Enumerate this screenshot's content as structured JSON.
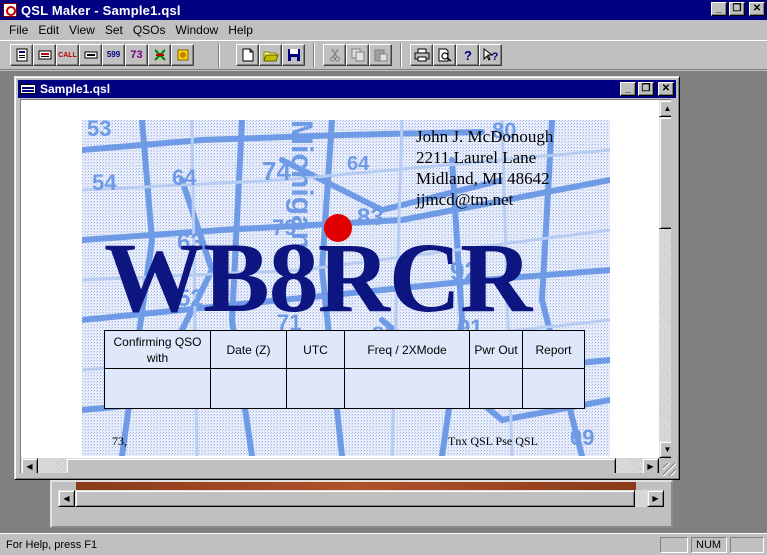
{
  "app": {
    "title": "QSL Maker - Sample1.qsl"
  },
  "window_buttons": {
    "minimize": "_",
    "restore": "❐",
    "close": "✕"
  },
  "menu": [
    "File",
    "Edit",
    "View",
    "Set",
    "QSOs",
    "Window",
    "Help"
  ],
  "toolbar": {
    "group1_labels": [
      "",
      "",
      "CALL",
      "",
      "599",
      "73",
      "",
      ""
    ],
    "group2": [
      "new-icon",
      "open-icon",
      "save-icon"
    ],
    "group3": [
      "cut-icon",
      "copy-icon",
      "paste-icon"
    ],
    "group4": [
      "print-icon",
      "print-preview-icon",
      "help-icon",
      "context-help-icon"
    ]
  },
  "document": {
    "title": "Sample1.qsl"
  },
  "card": {
    "address": [
      "John J. McDonough",
      "2211 Laurel Lane",
      "Midland, MI 48642",
      "jjmcd@tm.net"
    ],
    "callsign": "WB8RCR",
    "table_headers": [
      "Confirming QSO with",
      "Date (Z)",
      "UTC",
      "Freq / 2XMode",
      "Pwr Out",
      "Report"
    ],
    "footer_left": "73,",
    "footer_right": "Tnx QSL   Pse QSL",
    "map_numbers": [
      "53",
      "54",
      "64",
      "74",
      "80",
      "63",
      "79",
      "83",
      "52",
      "92",
      "71",
      "81",
      "91",
      "09",
      "64"
    ],
    "map_label": "Michigan",
    "dot_color": "#e00000",
    "callsign_color": "#0c1580"
  },
  "status": {
    "text": "For Help, press F1",
    "num": "NUM"
  }
}
